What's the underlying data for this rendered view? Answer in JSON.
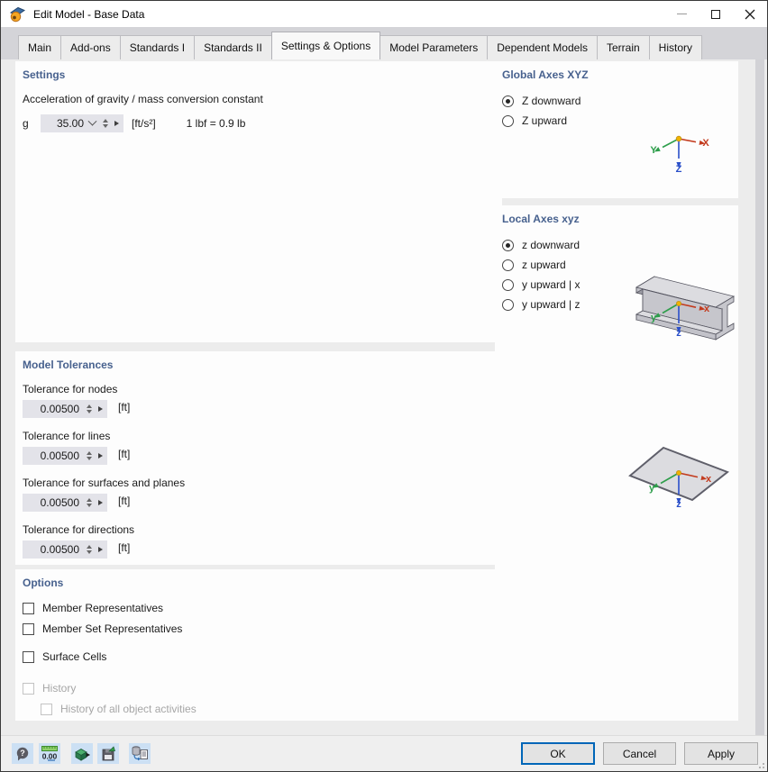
{
  "window": {
    "title": "Edit Model - Base Data"
  },
  "tabs": [
    "Main",
    "Add-ons",
    "Standards I",
    "Standards II",
    "Settings & Options",
    "Model Parameters",
    "Dependent Models",
    "Terrain",
    "History"
  ],
  "active_tab": "Settings & Options",
  "settings": {
    "header": "Settings",
    "gravity_label": "Acceleration of gravity / mass conversion constant",
    "g_symbol": "g",
    "g_value": "35.00",
    "g_unit": "[ft/s²]",
    "conversion_note": "1 lbf = 0.9 lb"
  },
  "tolerances": {
    "header": "Model Tolerances",
    "items": [
      {
        "label": "Tolerance for nodes",
        "value": "0.00500",
        "unit": "[ft]"
      },
      {
        "label": "Tolerance for lines",
        "value": "0.00500",
        "unit": "[ft]"
      },
      {
        "label": "Tolerance for surfaces and planes",
        "value": "0.00500",
        "unit": "[ft]"
      },
      {
        "label": "Tolerance for directions",
        "value": "0.00500",
        "unit": "[ft]"
      }
    ]
  },
  "options": {
    "header": "Options",
    "items": [
      {
        "label": "Member Representatives",
        "checked": false,
        "disabled": false
      },
      {
        "label": "Member Set Representatives",
        "checked": false,
        "disabled": false
      },
      {
        "label": "Surface Cells",
        "checked": false,
        "disabled": false
      },
      {
        "label": "History",
        "checked": false,
        "disabled": true
      },
      {
        "label": "History of all object activities",
        "checked": false,
        "disabled": true
      }
    ]
  },
  "global_axes": {
    "header": "Global Axes XYZ",
    "radios": [
      {
        "label": "Z downward",
        "selected": true
      },
      {
        "label": "Z upward",
        "selected": false
      }
    ],
    "labels": {
      "x": "X",
      "y": "Y",
      "z": "Z"
    }
  },
  "local_axes": {
    "header": "Local Axes xyz",
    "radios": [
      {
        "label": "z downward",
        "selected": true
      },
      {
        "label": "z upward",
        "selected": false
      },
      {
        "label": "y upward | x",
        "selected": false
      },
      {
        "label": "y upward | z",
        "selected": false
      }
    ],
    "labels": {
      "x": "x",
      "y": "y",
      "z": "z"
    }
  },
  "footer": {
    "buttons": {
      "ok": "OK",
      "cancel": "Cancel",
      "apply": "Apply"
    },
    "toolbar": [
      {
        "name": "help",
        "glyph": "?"
      },
      {
        "name": "units-and-decimal-places",
        "glyph": "0.00"
      },
      {
        "name": "import-settings",
        "glyph": ""
      },
      {
        "name": "save-as-default",
        "glyph": ""
      },
      {
        "name": "copy-settings",
        "glyph": ""
      }
    ]
  },
  "colors": {
    "section_header": "#47618E",
    "axis_x": "#C33B1E",
    "axis_y": "#2E9E4B",
    "axis_z": "#2A4FC9",
    "origin": "#F0B400",
    "focus_border": "#0066B8",
    "toolbar_icon_bg": "#CCE0F4"
  }
}
